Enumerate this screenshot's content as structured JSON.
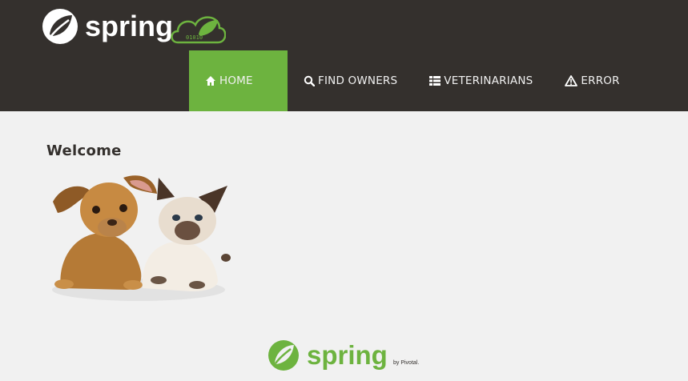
{
  "brand": {
    "name": "spring",
    "leaf_icon": "spring-leaf-icon",
    "badge_text": "01010",
    "accent": "#6db33f",
    "navbar_bg": "#34302d"
  },
  "nav": [
    {
      "label": "HOME",
      "icon": "home-icon",
      "active": true
    },
    {
      "label": "FIND OWNERS",
      "icon": "search-icon",
      "active": false
    },
    {
      "label": "VETERINARIANS",
      "icon": "list-icon",
      "active": false
    },
    {
      "label": "ERROR",
      "icon": "warning-icon",
      "active": false
    }
  ],
  "main": {
    "heading": "Welcome",
    "image": "pets-image"
  },
  "footer": {
    "brand": "spring",
    "by_text": "by Pivotal."
  }
}
